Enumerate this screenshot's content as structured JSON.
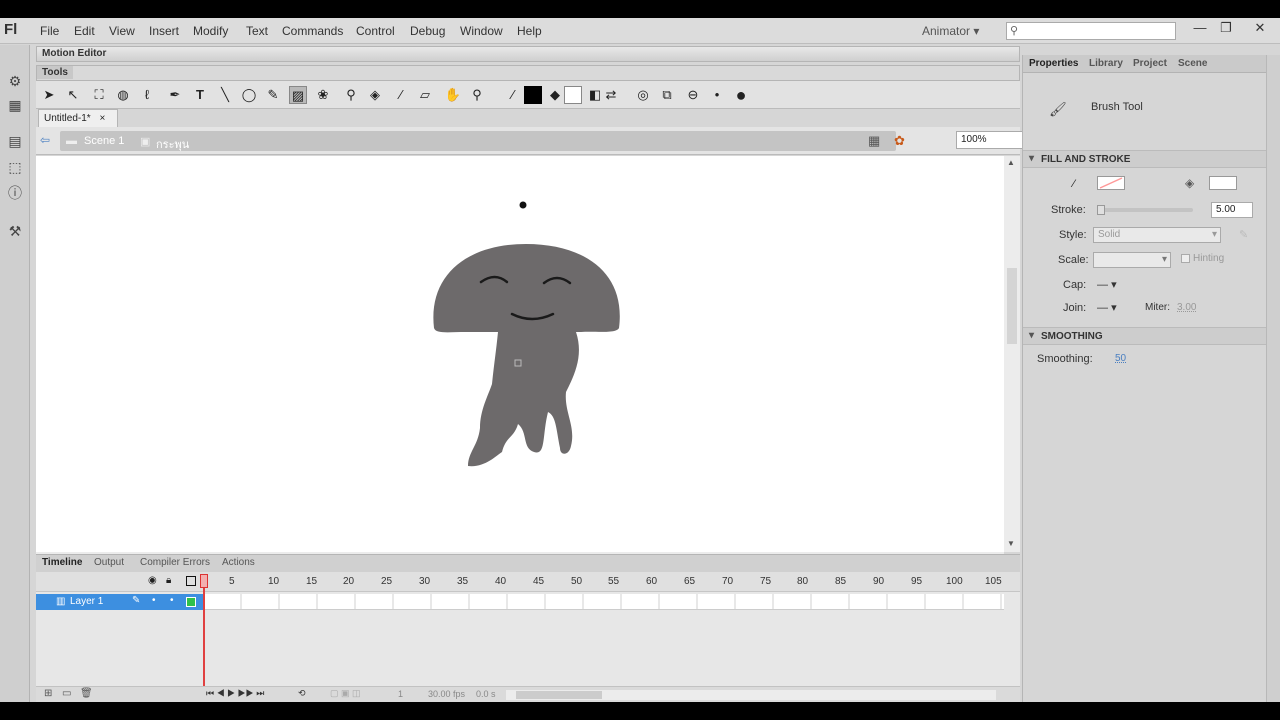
{
  "menu": {
    "logo": "Fl",
    "items": [
      "File",
      "Edit",
      "View",
      "Insert",
      "Modify",
      "Text",
      "Commands",
      "Control",
      "Debug",
      "Window",
      "Help"
    ],
    "workspace": "Animator",
    "workspace_arrow": "▾",
    "search_icon": "⚲",
    "minimize": "—",
    "restore": "❐",
    "close": "✕"
  },
  "panels": {
    "motion_editor": "Motion Editor",
    "tools": "Tools"
  },
  "document": {
    "tab": "Untitled-1*",
    "tab_close": "×",
    "scene": "Scene 1",
    "symbol": "กระพุน",
    "zoom": "100%",
    "zoom_arrow": "▾"
  },
  "timeline": {
    "tabs": [
      "Timeline",
      "Output",
      "Compiler Errors",
      "Actions"
    ],
    "frames": [
      "5",
      "10",
      "15",
      "20",
      "25",
      "30",
      "35",
      "40",
      "45",
      "50",
      "55",
      "60",
      "65",
      "70",
      "75",
      "80",
      "85",
      "90",
      "95",
      "100",
      "105"
    ],
    "layer_name": "Layer 1",
    "current_frame": "1",
    "fps": "30.00 fps",
    "time": "0.0 s"
  },
  "properties": {
    "tabs": [
      "Properties",
      "Library",
      "Project",
      "Scene"
    ],
    "tool_name": "Brush Tool",
    "fill_stroke_header": "FILL AND STROKE",
    "stroke_label": "Stroke:",
    "stroke_value": "5.00",
    "style_label": "Style:",
    "style_value": "Solid",
    "scale_label": "Scale:",
    "hinting_label": "Hinting",
    "cap_label": "Cap:",
    "cap_value": "—",
    "join_label": "Join:",
    "join_value": "—",
    "miter_label": "Miter:",
    "miter_value": "3.00",
    "smoothing_header": "SMOOTHING",
    "smoothing_label": "Smoothing:",
    "smoothing_value": "50",
    "stroke_color": "#ff9999",
    "fill_color": "#ffffff"
  },
  "colors": {
    "jellyfish": "#6d6a6b",
    "layer_select": "#3d8fe0",
    "playhead": "#e04040"
  }
}
